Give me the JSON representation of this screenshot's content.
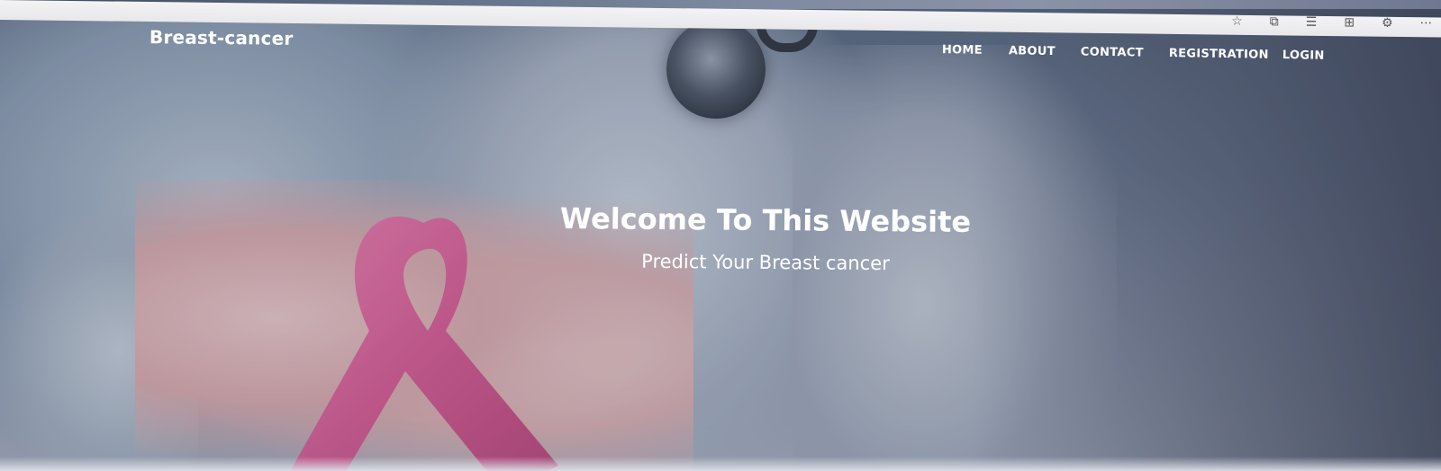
{
  "browser": {
    "icons": [
      "star-icon",
      "reading-icon",
      "favorites-icon",
      "collections-icon",
      "extension-icon",
      "more-icon"
    ],
    "more_label": "···"
  },
  "navbar": {
    "brand": "Breast-cancer",
    "items": [
      {
        "label": "HOME"
      },
      {
        "label": "ABOUT"
      },
      {
        "label": "CONTACT"
      },
      {
        "label": "REGISTRATION"
      },
      {
        "label": "LOGIN"
      }
    ]
  },
  "hero": {
    "title": "Welcome To This Website",
    "subtitle": "Predict Your Breast cancer"
  },
  "colors": {
    "text": "#ffffff",
    "ribbon": "#d8528f",
    "background_overlay": "#5a6982"
  }
}
